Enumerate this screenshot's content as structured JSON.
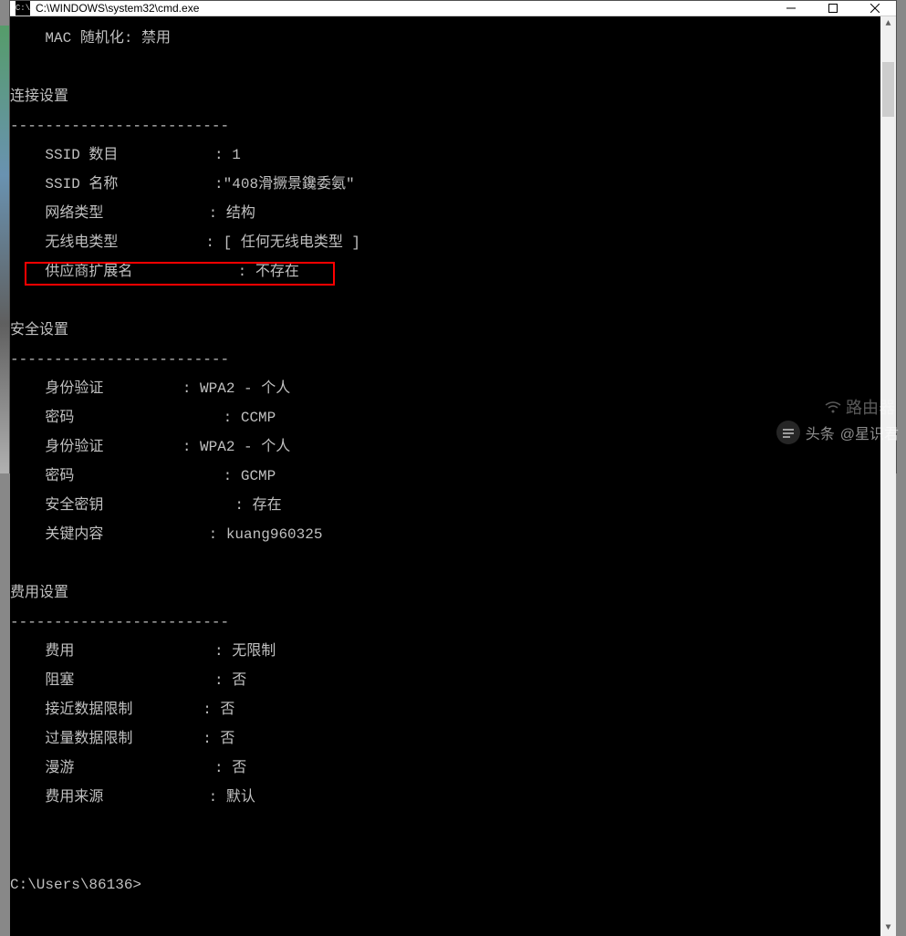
{
  "window": {
    "title": "C:\\WINDOWS\\system32\\cmd.exe",
    "icon_label": "C:\\"
  },
  "terminal": {
    "mac_line": "    MAC 随机化: 禁用",
    "blank": "",
    "conn_header": "连接设置",
    "divider": "-------------------------",
    "ssid_count": "    SSID 数目           : 1",
    "ssid_name": "    SSID 名称           :\"408滑撅景鑱委氨\"",
    "net_type": "    网络类型            : 结构",
    "radio_type": "    无线电类型          : [ 任何无线电类型 ]",
    "vendor_ext": "    供应商扩展名            : 不存在",
    "sec_header": "安全设置",
    "auth1": "    身份验证         : WPA2 - 个人",
    "cipher1": "    密码                 : CCMP",
    "auth2": "    身份验证         : WPA2 - 个人",
    "cipher2": "    密码                 : GCMP",
    "sec_key": "    安全密钥               : 存在",
    "key_content": "    关键内容            : kuang960325",
    "cost_header": "费用设置",
    "cost": "    费用                : 无限制",
    "congested": "    阻塞                : 否",
    "near_limit": "    接近数据限制        : 否",
    "over_limit": "    过量数据限制        : 否",
    "roaming": "    漫游                : 否",
    "cost_source": "    费用来源            : 默认",
    "prompt": "C:\\Users\\86136>"
  },
  "watermark": {
    "router": "路由器",
    "prefix": "头条",
    "handle": "@星识君"
  }
}
